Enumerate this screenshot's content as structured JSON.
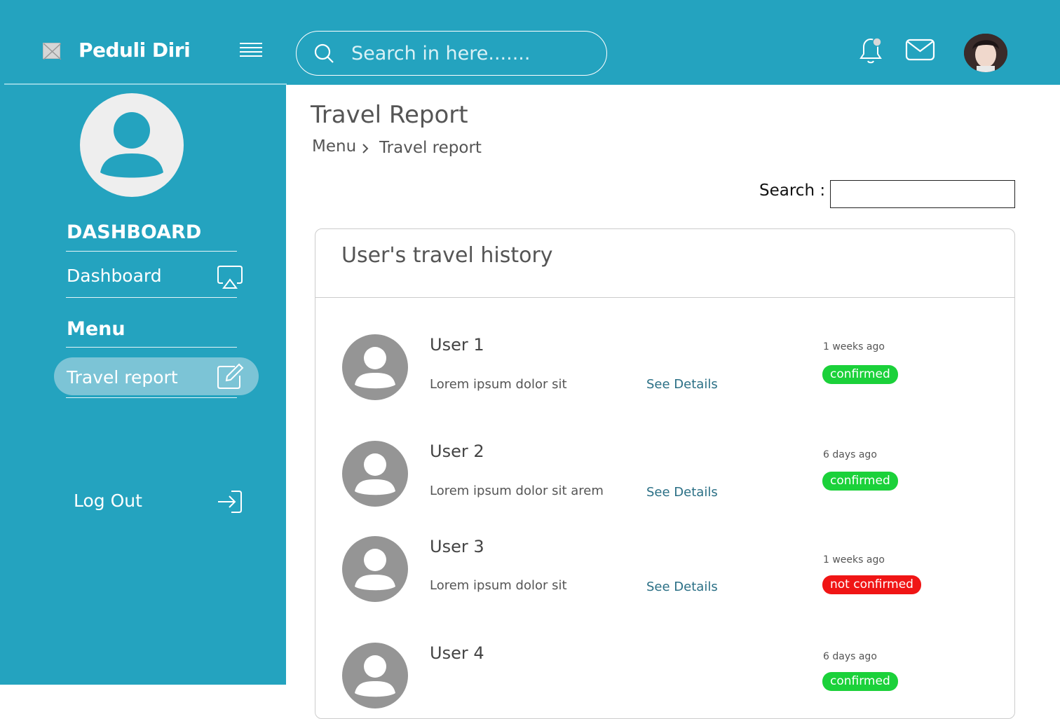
{
  "header": {
    "app_title": "Peduli Diri",
    "search_placeholder": "Search in here......."
  },
  "sidebar": {
    "dashboard_heading": "DASHBOARD",
    "dashboard_item": "Dashboard",
    "menu_heading": "Menu",
    "travel_item": "Travel report",
    "logout": "Log Out"
  },
  "main": {
    "page_title": "Travel Report",
    "breadcrumb": [
      "Menu",
      "Travel report"
    ],
    "search_label": "Search :",
    "card_title": "User's travel history",
    "link_label": "See Details",
    "rows": [
      {
        "name": "User 1",
        "desc": "Lorem ipsum dolor sit",
        "time": "1 weeks ago",
        "status": "confirmed",
        "status_color": "#1bd13a"
      },
      {
        "name": "User 2",
        "desc": "Lorem ipsum dolor sit arem",
        "time": "6 days ago",
        "status": "confirmed",
        "status_color": "#1bd13a"
      },
      {
        "name": "User 3",
        "desc": "Lorem ipsum dolor sit",
        "time": "1 weeks ago",
        "status": "not confirmed",
        "status_color": "#f01515"
      },
      {
        "name": "User 4",
        "desc": "",
        "time": "6 days ago",
        "status": "confirmed",
        "status_color": "#1bd13a"
      }
    ]
  },
  "colors": {
    "primary": "#24a3bf",
    "active_pill": "#7cc4d6",
    "link": "#2a6f85"
  }
}
